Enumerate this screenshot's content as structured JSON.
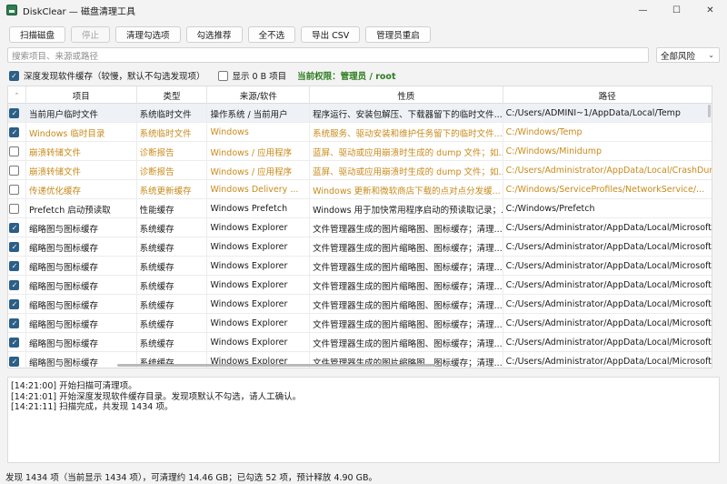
{
  "window": {
    "title": "DiskClear — 磁盘清理工具",
    "controls": {
      "minimize": "—",
      "maximize": "☐",
      "close": "✕"
    }
  },
  "toolbar": {
    "buttons": [
      {
        "label": "扫描磁盘",
        "enabled": true
      },
      {
        "label": "停止",
        "enabled": false
      },
      {
        "label": "清理勾选项",
        "enabled": true
      },
      {
        "label": "勾选推荐",
        "enabled": true
      },
      {
        "label": "全不选",
        "enabled": true
      },
      {
        "label": "导出 CSV",
        "enabled": true
      },
      {
        "label": "管理员重启",
        "enabled": true
      }
    ]
  },
  "search": {
    "placeholder": "搜索项目、来源或路径",
    "risk_filter": "全部风险"
  },
  "options": {
    "deep_scan": {
      "label": "深度发现软件缓存（较慢，默认不勾选发现项）",
      "checked": true
    },
    "show_zero": {
      "label": "显示 0 B 项目",
      "checked": false
    },
    "permission": "当前权限：管理员 / root"
  },
  "table": {
    "columns": [
      "项目",
      "类型",
      "来源/软件",
      "性质",
      "路径"
    ],
    "rows": [
      {
        "checked": true,
        "warn": false,
        "selected": true,
        "item": "当前用户临时文件",
        "type": "系统临时文件",
        "source": "操作系统 / 当前用户",
        "nature": "程序运行、安装包解压、下载器留下的临时文件...",
        "path": "C:/Users/ADMINI~1/AppData/Local/Temp"
      },
      {
        "checked": true,
        "warn": true,
        "selected": false,
        "item": "Windows 临时目录",
        "type": "系统临时文件",
        "source": "Windows",
        "nature": "系统服务、驱动安装和维护任务留下的临时文件...",
        "path": "C:/Windows/Temp"
      },
      {
        "checked": false,
        "warn": true,
        "selected": false,
        "item": "崩溃转储文件",
        "type": "诊断报告",
        "source": "Windows / 应用程序",
        "nature": "蓝屏、驱动或应用崩溃时生成的 dump 文件；如...",
        "path": "C:/Windows/Minidump"
      },
      {
        "checked": false,
        "warn": true,
        "selected": false,
        "item": "崩溃转储文件",
        "type": "诊断报告",
        "source": "Windows / 应用程序",
        "nature": "蓝屏、驱动或应用崩溃时生成的 dump 文件；如...",
        "path": "C:/Users/Administrator/AppData/Local/CrashDump"
      },
      {
        "checked": false,
        "warn": true,
        "selected": false,
        "item": "传递优化缓存",
        "type": "系统更新缓存",
        "source": "Windows Delivery ...",
        "nature": "Windows 更新和微软商店下载的点对点分发缓...",
        "path": "C:/Windows/ServiceProfiles/NetworkService/..."
      },
      {
        "checked": false,
        "warn": false,
        "selected": false,
        "item": "Prefetch 启动预读取",
        "type": "性能缓存",
        "source": "Windows Prefetch",
        "nature": "Windows 用于加快常用程序启动的预读取记录；...",
        "path": "C:/Windows/Prefetch"
      },
      {
        "checked": true,
        "warn": false,
        "selected": false,
        "item": "缩略图与图标缓存",
        "type": "系统缓存",
        "source": "Windows Explorer",
        "nature": "文件管理器生成的图片缩略图、图标缓存；清理...",
        "path": "C:/Users/Administrator/AppData/Local/Microsoft/..."
      },
      {
        "checked": true,
        "warn": false,
        "selected": false,
        "item": "缩略图与图标缓存",
        "type": "系统缓存",
        "source": "Windows Explorer",
        "nature": "文件管理器生成的图片缩略图、图标缓存；清理...",
        "path": "C:/Users/Administrator/AppData/Local/Microsoft/..."
      },
      {
        "checked": true,
        "warn": false,
        "selected": false,
        "item": "缩略图与图标缓存",
        "type": "系统缓存",
        "source": "Windows Explorer",
        "nature": "文件管理器生成的图片缩略图、图标缓存；清理...",
        "path": "C:/Users/Administrator/AppData/Local/Microsoft/..."
      },
      {
        "checked": true,
        "warn": false,
        "selected": false,
        "item": "缩略图与图标缓存",
        "type": "系统缓存",
        "source": "Windows Explorer",
        "nature": "文件管理器生成的图片缩略图、图标缓存；清理...",
        "path": "C:/Users/Administrator/AppData/Local/Microsoft/..."
      },
      {
        "checked": true,
        "warn": false,
        "selected": false,
        "item": "缩略图与图标缓存",
        "type": "系统缓存",
        "source": "Windows Explorer",
        "nature": "文件管理器生成的图片缩略图、图标缓存；清理...",
        "path": "C:/Users/Administrator/AppData/Local/Microsoft/..."
      },
      {
        "checked": true,
        "warn": false,
        "selected": false,
        "item": "缩略图与图标缓存",
        "type": "系统缓存",
        "source": "Windows Explorer",
        "nature": "文件管理器生成的图片缩略图、图标缓存；清理...",
        "path": "C:/Users/Administrator/AppData/Local/Microsoft/..."
      },
      {
        "checked": true,
        "warn": false,
        "selected": false,
        "item": "缩略图与图标缓存",
        "type": "系统缓存",
        "source": "Windows Explorer",
        "nature": "文件管理器生成的图片缩略图、图标缓存；清理...",
        "path": "C:/Users/Administrator/AppData/Local/Microsoft/..."
      },
      {
        "checked": true,
        "warn": false,
        "selected": false,
        "item": "缩略图与图标缓存",
        "type": "系统缓存",
        "source": "Windows Explorer",
        "nature": "文件管理器生成的图片缩略图、图标缓存；清理...",
        "path": "C:/Users/Administrator/AppData/Local/Microsoft/..."
      }
    ]
  },
  "log": {
    "lines": [
      "[14:21:00] 开始扫描可清理项。",
      "[14:21:01] 开始深度发现软件缓存目录。发现项默认不勾选，请人工确认。",
      "[14:21:11] 扫描完成，共发现 1434 项。"
    ]
  },
  "status": "发现 1434 项（当前显示 1434 项），可清理约 14.46 GB；已勾选 52 项，预计释放 4.90 GB。",
  "colors": {
    "warn_text": "#c98a1b",
    "permission_text": "#2e7d1f",
    "checkbox_checked": "#2b5f87"
  }
}
